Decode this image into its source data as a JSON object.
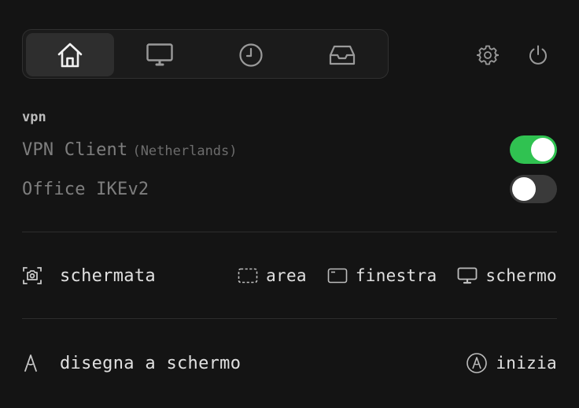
{
  "tabs": [
    {
      "name": "home",
      "icon": "home-icon",
      "active": true
    },
    {
      "name": "display",
      "icon": "monitor-icon",
      "active": false
    },
    {
      "name": "history",
      "icon": "clock-icon",
      "active": false
    },
    {
      "name": "inbox",
      "icon": "inbox-icon",
      "active": false
    }
  ],
  "header_icons": [
    "gear-icon",
    "power-icon"
  ],
  "vpn": {
    "section_label": "vpn",
    "connections": [
      {
        "name": "VPN Client",
        "location": "(Netherlands)",
        "enabled": true
      },
      {
        "name": "Office IKEv2",
        "location": "",
        "enabled": false
      }
    ]
  },
  "screenshot": {
    "label": "schermata",
    "icon": "camera-icon",
    "actions": [
      {
        "label": "area",
        "icon": "dashed-rect-icon"
      },
      {
        "label": "finestra",
        "icon": "window-icon"
      },
      {
        "label": "schermo",
        "icon": "monitor-icon"
      }
    ]
  },
  "draw": {
    "label": "disegna a schermo",
    "icon": "pen-icon",
    "action_label": "inizia",
    "action_icon": "pen-circle-icon"
  },
  "colors": {
    "background": "#141414",
    "toggle_on": "#30c251",
    "toggle_off": "#3a3a3a",
    "text": "#e0e0e0",
    "muted": "#7e7e7e"
  }
}
